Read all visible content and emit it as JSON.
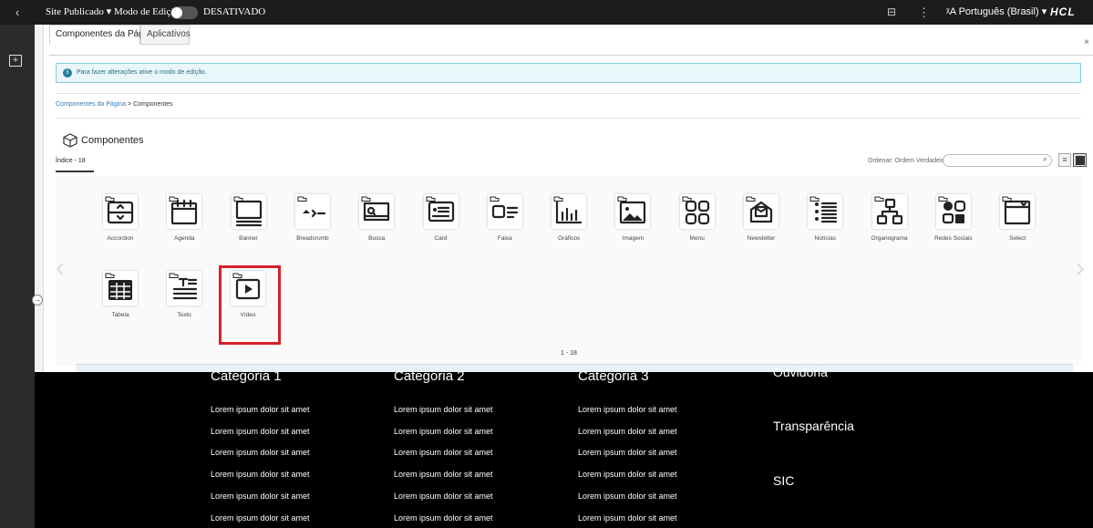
{
  "topbar": {
    "back": "‹",
    "site_status": "Site Publicado",
    "edit_mode_label": "Modo de Edição:",
    "edit_mode_state": "DESATIVADO",
    "language": "Português (Brasil)",
    "logo": "HCL"
  },
  "tabs": [
    "Componentes da Página",
    "Aplicativos"
  ],
  "info_message": "Para fazer alterações ative o modo de edição.",
  "breadcrumb": {
    "link": "Componentes da Página",
    "separator": ">",
    "current": "Componentes"
  },
  "section_title": "Componentes",
  "index_tab": "Índice - 18",
  "sort": {
    "label": "Ordenar:",
    "value": "Ordem Verdadeira"
  },
  "components": [
    {
      "label": "Accordion",
      "icon": "accordion-icon"
    },
    {
      "label": "Agenda",
      "icon": "calendar-icon"
    },
    {
      "label": "Banner",
      "icon": "banner-icon"
    },
    {
      "label": "Breadcrumb",
      "icon": "breadcrumb-icon"
    },
    {
      "label": "Busca",
      "icon": "search-box-icon"
    },
    {
      "label": "Card",
      "icon": "card-icon"
    },
    {
      "label": "Faixa",
      "icon": "strip-icon"
    },
    {
      "label": "Gráficos",
      "icon": "bar-chart-icon"
    },
    {
      "label": "Imagem",
      "icon": "image-icon"
    },
    {
      "label": "Menu",
      "icon": "grid-menu-icon"
    },
    {
      "label": "Newsletter",
      "icon": "envelope-icon"
    },
    {
      "label": "Notícias",
      "icon": "list-icon"
    },
    {
      "label": "Organograma",
      "icon": "org-chart-icon"
    },
    {
      "label": "Redes Sociais",
      "icon": "social-icon"
    },
    {
      "label": "Select",
      "icon": "select-icon"
    },
    {
      "label": "Tabela",
      "icon": "table-icon"
    },
    {
      "label": "Texto",
      "icon": "text-icon"
    },
    {
      "label": "Vídeo",
      "icon": "play-icon"
    }
  ],
  "pager": "1 - 18",
  "highlight_color": "#d8202a",
  "footer": {
    "columns": [
      {
        "heading": "Categoria 1",
        "items": [
          "Lorem ipsum dolor sit amet",
          "Lorem ipsum dolor sit amet",
          "Lorem ipsum dolor sit amet",
          "Lorem ipsum dolor sit amet",
          "Lorem ipsum dolor sit amet",
          "Lorem ipsum dolor sit amet"
        ]
      },
      {
        "heading": "Categoria 2",
        "items": [
          "Lorem ipsum dolor sit amet",
          "Lorem ipsum dolor sit amet",
          "Lorem ipsum dolor sit amet",
          "Lorem ipsum dolor sit amet",
          "Lorem ipsum dolor sit amet",
          "Lorem ipsum dolor sit amet"
        ]
      },
      {
        "heading": "Categoria 3",
        "items": [
          "Lorem ipsum dolor sit amet",
          "Lorem ipsum dolor sit amet",
          "Lorem ipsum dolor sit amet",
          "Lorem ipsum dolor sit amet",
          "Lorem ipsum dolor sit amet",
          "Lorem ipsum dolor sit amet"
        ]
      }
    ],
    "links": [
      "Ouvidoria",
      "Transparência",
      "SIC"
    ]
  }
}
